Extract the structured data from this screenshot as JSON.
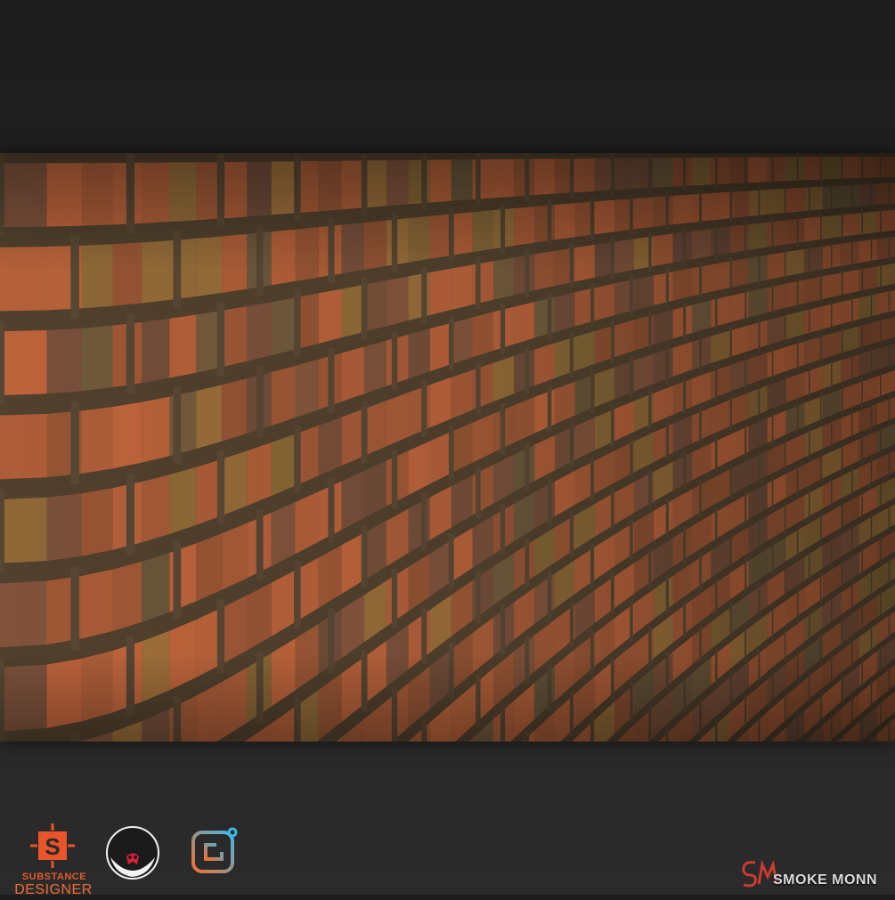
{
  "render": {
    "subject": "brick-wall-material-preview",
    "colors": {
      "background_top": "#1c1c1d",
      "background_bottom": "#2b2b2c",
      "brick": "#c8693e",
      "brick_dark": "#7a4a30",
      "mortar": "#5c4a35",
      "moss": "#6c8a3a"
    }
  },
  "logos": {
    "substance": {
      "line1": "SUBSTANCE",
      "line2": "DESIGNER",
      "icon": "substance-designer-logo",
      "color": "#e9552a"
    },
    "mascot": {
      "icon": "round-mascot-face-logo"
    },
    "app": {
      "icon": "rounded-square-app-logo",
      "color_from": "#f0702f",
      "color_to": "#3fb6e6"
    }
  },
  "signature": {
    "text": "SMOKE MONN",
    "mark": "SM",
    "color": "#cc3b2f"
  }
}
